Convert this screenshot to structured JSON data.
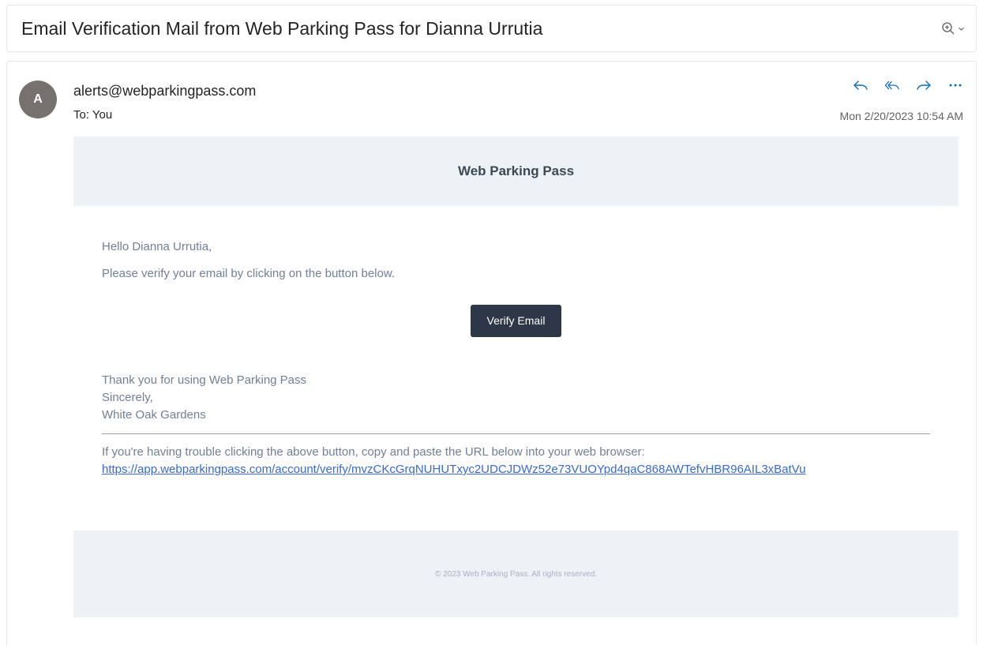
{
  "subject": {
    "title": "Email Verification Mail from Web Parking Pass for Dianna Urrutia"
  },
  "toolbar": {
    "zoom_icon": "zoom-in-icon",
    "dropdown_icon": "chevron-down-icon"
  },
  "message": {
    "avatar_initial": "A",
    "sender": "alerts@webparkingpass.com",
    "to_line": "To: You",
    "timestamp": "Mon 2/20/2023 10:54 AM",
    "actions": [
      "reply-icon",
      "reply-all-icon",
      "forward-icon",
      "more-icon"
    ],
    "avatar_color": "#76706f",
    "action_color": "#0f6cbd"
  },
  "email": {
    "brand": "Web Parking Pass",
    "greeting": "Hello Dianna Urrutia,",
    "intro": "Please verify your email by clicking on the button below.",
    "button_label": "Verify Email",
    "closing_line1": "Thank you for using Web Parking Pass",
    "closing_line2": "Sincerely,",
    "closing_line3": "White Oak Gardens",
    "trouble_text": "If you're having trouble clicking the above button, copy and paste the URL below into your web browser:",
    "verify_url": "https://app.webparkingpass.com/account/verify/mvzCKcGrqNUHUTxyc2UDCJDWz52e73VUOYpd4qaC868AWTefvHBR96AIL3xBatVu",
    "copyright": "© 2023 Web Parking Pass. All rights reserved.",
    "header_bg": "#edf2f7",
    "button_bg": "#2d3748",
    "link_color": "#3869d4"
  }
}
